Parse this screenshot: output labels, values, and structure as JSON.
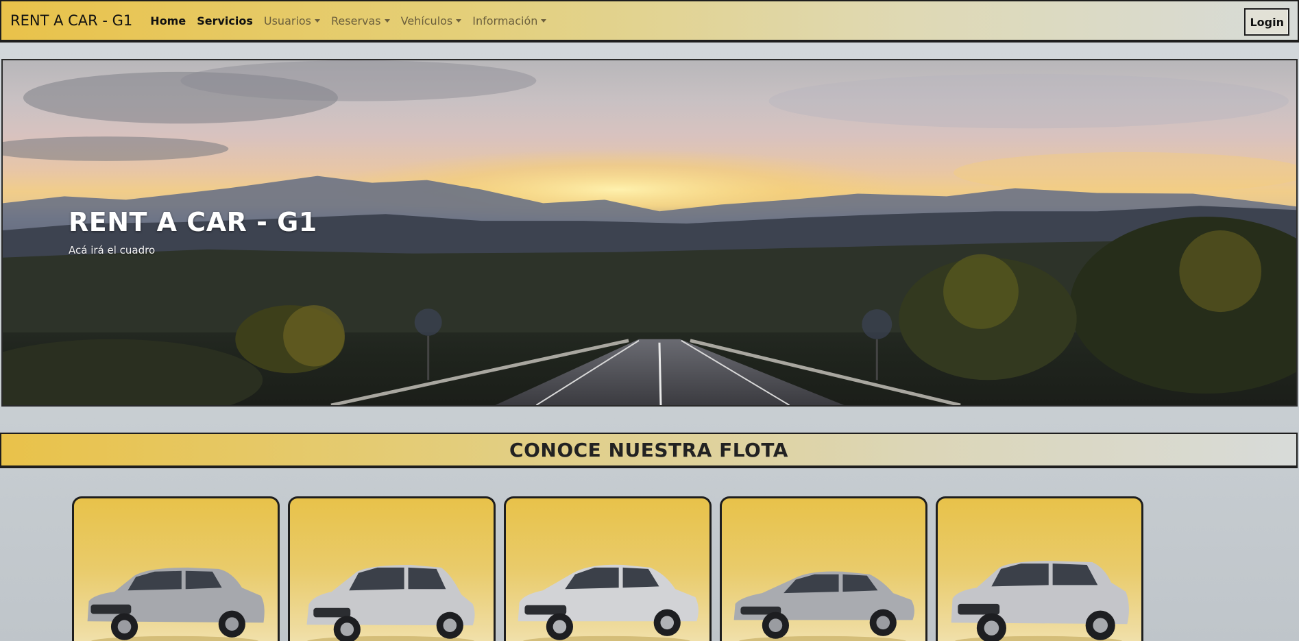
{
  "navbar": {
    "brand": "RENT A CAR - G1",
    "items": [
      {
        "label": "Home",
        "dropdown": false
      },
      {
        "label": "Servicios",
        "dropdown": false
      },
      {
        "label": "Usuarios",
        "dropdown": true
      },
      {
        "label": "Reservas",
        "dropdown": true
      },
      {
        "label": "Vehículos",
        "dropdown": true
      },
      {
        "label": "Información",
        "dropdown": true
      }
    ],
    "login_label": "Login"
  },
  "hero": {
    "title": "RENT A CAR - G1",
    "subtitle": "Acá irá el cuadro"
  },
  "fleet": {
    "title": "CONOCE NUESTRA FLOTA",
    "cards": [
      {
        "image": "car-hatchback-small"
      },
      {
        "image": "car-hatchback-compact"
      },
      {
        "image": "car-sedan"
      },
      {
        "image": "car-sedan-focus"
      },
      {
        "image": "car-suv"
      }
    ]
  },
  "colors": {
    "accent_gold": "#e9c24a",
    "border_dark": "#1e1e1e",
    "page_bg": "#d3d8dc"
  }
}
